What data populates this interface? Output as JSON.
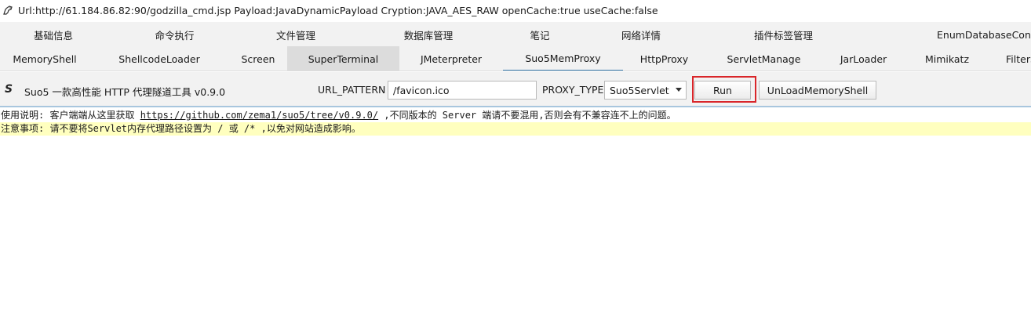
{
  "window": {
    "title": "Url:http://61.184.86.82:90/godzilla_cmd.jsp Payload:JavaDynamicPayload Cryption:JAVA_AES_RAW openCache:true useCache:false",
    "icon": "godzilla-app-icon"
  },
  "tabs_row1": [
    {
      "label": "基础信息"
    },
    {
      "label": "命令执行"
    },
    {
      "label": "文件管理"
    },
    {
      "label": "数据库管理"
    },
    {
      "label": "笔记"
    },
    {
      "label": "网络详情"
    },
    {
      "label": "插件标签管理"
    },
    {
      "label": "EnumDatabaseConn"
    }
  ],
  "tabs_row2": [
    {
      "label": "MemoryShell"
    },
    {
      "label": "ShellcodeLoader"
    },
    {
      "label": "Screen"
    },
    {
      "label": "SuperTerminal"
    },
    {
      "label": "JMeterpreter"
    },
    {
      "label": "Suo5MemProxy"
    },
    {
      "label": "HttpProxy"
    },
    {
      "label": "ServletManage"
    },
    {
      "label": "JarLoader"
    },
    {
      "label": "Mimikatz"
    },
    {
      "label": "FilterShell"
    }
  ],
  "plugin": {
    "logo_text": "S",
    "title": "Suo5 一款高性能 HTTP 代理隧道工具 v0.9.0",
    "url_pattern_label": "URL_PATTERN",
    "url_pattern_value": "/favicon.ico",
    "proxy_type_label": "PROXY_TYPE",
    "proxy_type_value": "Suo5Servlet",
    "run_label": "Run",
    "unload_label": "UnLoadMemoryShell"
  },
  "console": {
    "line1_prefix": "使用说明: 客户端端从这里获取 ",
    "line1_link": "https://github.com/zema1/suo5/tree/v0.9.0/",
    "line1_suffix": " ,不同版本的 Server 端请不要混用,否则会有不兼容连不上的问题。",
    "line2": "注意事项: 请不要将Servlet内存代理路径设置为 / 或 /* ,以免对网站造成影响。"
  },
  "colors": {
    "tab_bg": "#f2f2f2",
    "tab_active_bg": "#dcdcdc",
    "current_tab_underline": "#3c7fb1",
    "run_highlight": "#d9262a",
    "warning_line_bg": "#ffffbf"
  }
}
